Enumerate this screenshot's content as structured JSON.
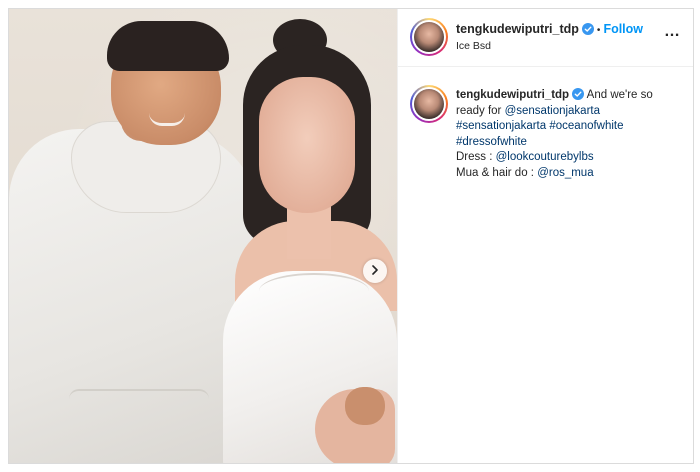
{
  "post": {
    "header": {
      "username": "tengkudewiputri_tdp",
      "separator": "•",
      "follow_label": "Follow",
      "location": "Ice Bsd",
      "more_label": "…"
    },
    "caption": {
      "username": "tengkudewiputri_tdp",
      "line1_text": "And we're so ready for ",
      "mention_event": "@sensationjakarta",
      "hashtag_1": "#sensationjakarta",
      "hashtag_2": "#oceanofwhite",
      "hashtag_3": "#dressofwhite",
      "dress_label": "Dress : ",
      "mention_dress": "@lookcouturebylbs",
      "mua_label": "Mua & hair do : ",
      "mention_mua": "@ros_mua"
    },
    "icons": {
      "verified": "verified-badge-icon",
      "carousel_next": "chevron-right-icon",
      "more": "more-options-icon"
    },
    "colors": {
      "link_blue": "#0095f6",
      "tag_blue": "#00376b",
      "text": "#262626",
      "border": "#dbdbdb"
    }
  }
}
